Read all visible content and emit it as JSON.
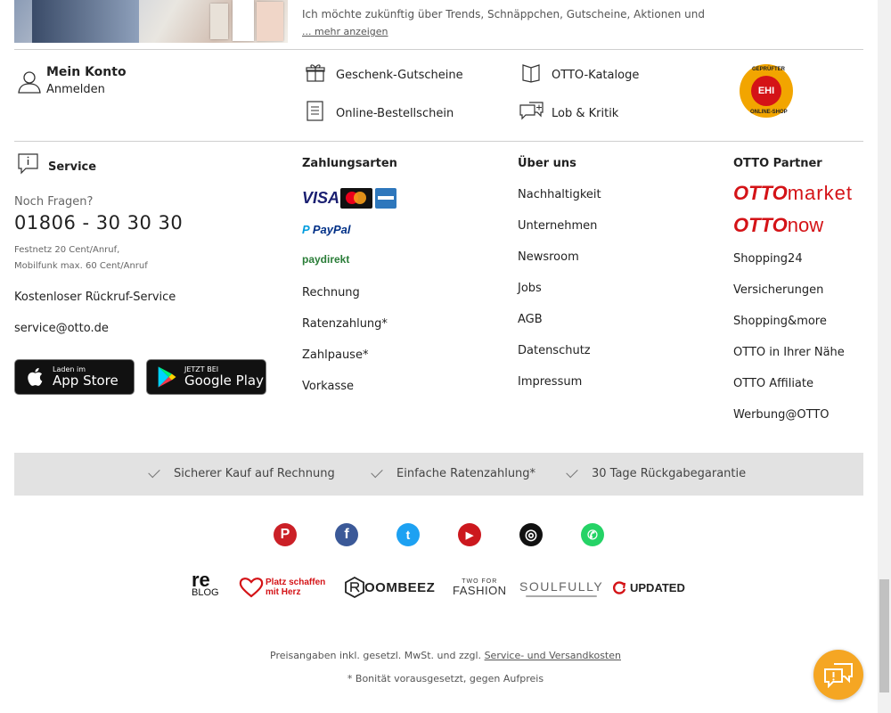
{
  "promo": {
    "text": "Ich möchte zukünftig über Trends, Schnäppchen, Gutscheine, Aktionen und",
    "more": "... mehr anzeigen"
  },
  "account": {
    "title": "Mein Konto",
    "login": "Anmelden"
  },
  "quick_links": {
    "gift": "Geschenk-Gutscheine",
    "catalogs": "OTTO-Kataloge",
    "order_form": "Online-Bestellschein",
    "feedback": "Lob & Kritik"
  },
  "ehi": {
    "center": "EHI",
    "top": "GEPRÜFTER",
    "bottom": "ONLINE-SHOP"
  },
  "service": {
    "title": "Service",
    "question": "Noch Fragen?",
    "phone": "01806 - 30 30 30",
    "fee1": "Festnetz 20 Cent/Anruf,",
    "fee2": "Mobilfunk max. 60 Cent/Anruf",
    "callback": "Kostenloser Rückruf-Service",
    "email": "service@otto.de",
    "appstore_small": "Laden im",
    "appstore_big": "App Store",
    "googleplay_small": "JETZT BEI",
    "googleplay_big": "Google Play"
  },
  "payment": {
    "title": "Zahlungsarten",
    "visa": "VISA",
    "paypal": "PayPal",
    "paydirekt": "paydirekt",
    "links": [
      "Rechnung",
      "Ratenzahlung*",
      "Zahlpause*",
      "Vorkasse"
    ]
  },
  "about": {
    "title": "Über uns",
    "links": [
      "Nachhaltigkeit",
      "Unternehmen",
      "Newsroom",
      "Jobs",
      "AGB",
      "Datenschutz",
      "Impressum"
    ]
  },
  "partner": {
    "title": "OTTO Partner",
    "market_a": "OTTO",
    "market_b": "market",
    "now_a": "OTTO",
    "now_b": "now",
    "links": [
      "Shopping24",
      "Versicherungen",
      "Shopping&more",
      "OTTO in Ihrer Nähe",
      "OTTO Affiliate",
      "Werbung@OTTO"
    ]
  },
  "benefits": [
    "Sicherer Kauf auf Rechnung",
    "Einfache Ratenzahlung*",
    "30 Tage Rückgabegarantie"
  ],
  "social": {
    "pinterest": {
      "icon": "pinterest-icon",
      "color": "#cb2027",
      "glyph": "P"
    },
    "facebook": {
      "icon": "facebook-icon",
      "color": "#3b5998",
      "glyph": "f"
    },
    "twitter": {
      "icon": "twitter-icon",
      "color": "#1da1f2",
      "glyph": "t"
    },
    "youtube": {
      "icon": "youtube-icon",
      "color": "#cc181e",
      "glyph": "▶"
    },
    "instagram": {
      "icon": "instagram-icon",
      "color": "#111111",
      "glyph": "◎"
    },
    "whatsapp": {
      "icon": "whatsapp-icon",
      "color": "#25d366",
      "glyph": "✆"
    }
  },
  "brands": {
    "reblog_a": "re",
    "reblog_b": "BLOG",
    "herz": "Platz schaffen mit Herz",
    "roombeez": "OOMBEEZ",
    "twofor_small": "TWO FOR",
    "twofor_big": "FASHION",
    "soulfully": "SOULFULLY",
    "updated": "UPDATED"
  },
  "footer": {
    "prices": "Preisangaben inkl. gesetzl. MwSt. und zzgl.",
    "shipping_link": "Service- und Versandkosten",
    "note": "* Bonität vorausgesetzt, gegen Aufpreis"
  },
  "colors": {
    "accent": "#d41317",
    "chat": "#f5a623"
  }
}
